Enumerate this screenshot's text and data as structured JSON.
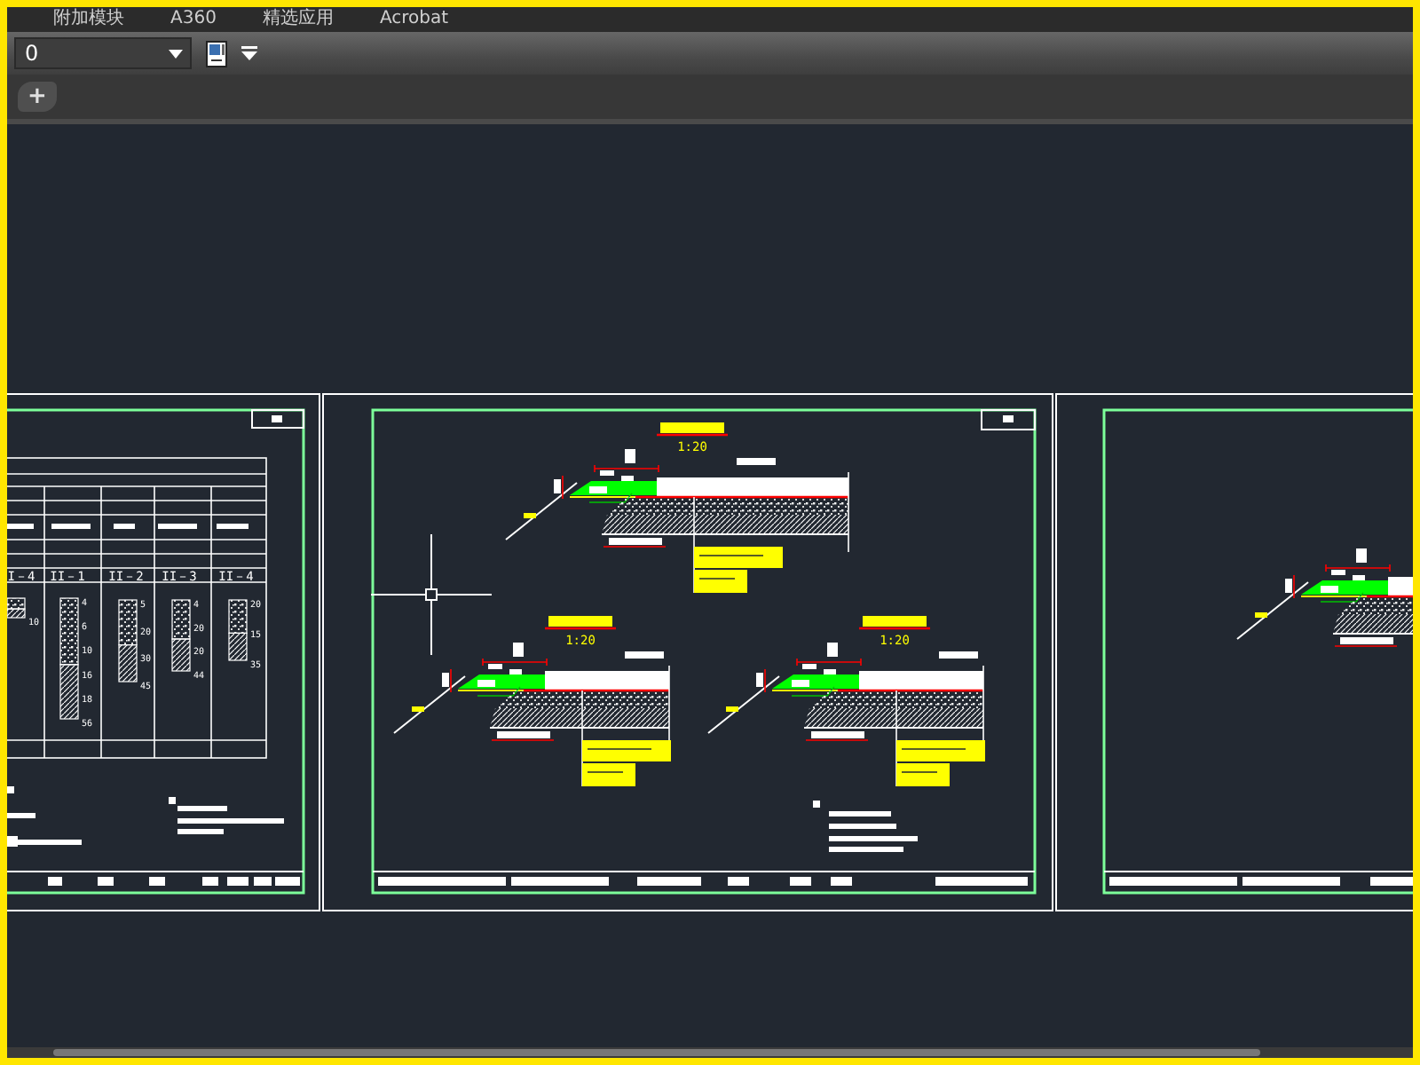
{
  "menu": [
    {
      "label": "附加模块"
    },
    {
      "label": "A360"
    },
    {
      "label": "精选应用"
    },
    {
      "label": "Acrobat"
    }
  ],
  "toolbar": {
    "layer_value": "0"
  },
  "file_tabs": {
    "add_label": "+"
  },
  "layer_table": {
    "columns": [
      {
        "label": "I－4",
        "thicknesses": [
          "10"
        ]
      },
      {
        "label": "II－1",
        "thicknesses": [
          "4",
          "6",
          "10",
          "16",
          "18",
          "56"
        ]
      },
      {
        "label": "II－2",
        "thicknesses": [
          "5",
          "20",
          "30",
          "45"
        ]
      },
      {
        "label": "II－3",
        "thicknesses": [
          "4",
          "20",
          "20",
          "44"
        ]
      },
      {
        "label": "II－4",
        "thicknesses": [
          "20",
          "15",
          "35"
        ]
      }
    ]
  },
  "sections": [
    {
      "scale": "1:20"
    },
    {
      "scale": "1:20"
    },
    {
      "scale": "1:20"
    }
  ]
}
